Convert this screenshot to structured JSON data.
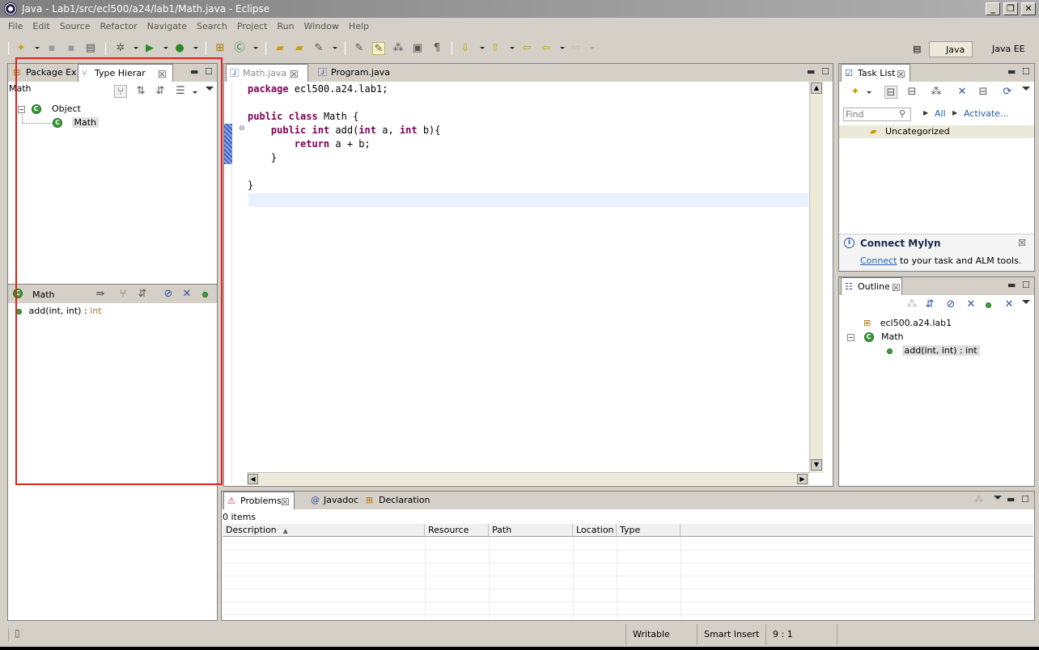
{
  "window": {
    "title": "Java - Lab1/src/ecl500/a24/lab1/Math.java - Eclipse",
    "controls": [
      "_",
      "❐",
      "✕"
    ]
  },
  "menu": [
    "File",
    "Edit",
    "Source",
    "Refactor",
    "Navigate",
    "Search",
    "Project",
    "Run",
    "Window",
    "Help"
  ],
  "perspectives": {
    "java": "Java",
    "javaee": "Java EE"
  },
  "left_panel": {
    "tabs": [
      "Package Ex",
      "Type Hierar"
    ],
    "title": "Math",
    "tree": {
      "root": "Object",
      "child": "Math"
    },
    "members_header": "Math",
    "members": [
      {
        "name": "add(int, int)",
        "sep": " : ",
        "type": "int"
      }
    ]
  },
  "editor": {
    "tabs": [
      "Math.java",
      "Program.java"
    ],
    "code": {
      "line1_kw": "package",
      "line1_rest": " ecl500.a24.lab1;",
      "line3_kw1": "public",
      "line3_kw2": "class",
      "line3_rest": " Math {",
      "line4_kw1": "public",
      "line4_kw2": "int",
      "line4_mid": " add(",
      "line4_kw3": "int",
      "line4_mid2": " a, ",
      "line4_kw4": "int",
      "line4_end": " b){",
      "line5_kw": "return",
      "line5_rest": " a + b;",
      "line6": "}",
      "line8": "}"
    }
  },
  "task_list": {
    "tab": "Task List",
    "find_placeholder": "Find",
    "all_label": "All",
    "activate_label": "Activate...",
    "category": "Uncategorized",
    "mylyn_title": "Connect Mylyn",
    "mylyn_link": "Connect",
    "mylyn_text": " to your task and ALM tools."
  },
  "outline": {
    "tab": "Outline",
    "package": "ecl500.a24.lab1",
    "class": "Math",
    "method": "add(int, int) : int"
  },
  "problems": {
    "tabs": [
      "Problems",
      "Javadoc",
      "Declaration"
    ],
    "count": "0 items",
    "columns": [
      "Description",
      "Resource",
      "Path",
      "Location",
      "Type"
    ]
  },
  "status": {
    "writable": "Writable",
    "insert_mode": "Smart Insert",
    "position": "9 : 1"
  }
}
